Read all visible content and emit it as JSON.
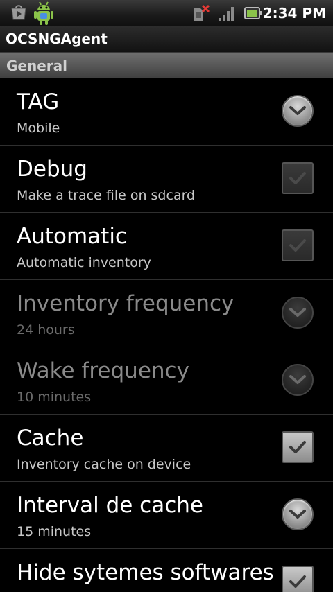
{
  "status_bar": {
    "time": "2:34 PM",
    "icons": [
      "play-store-notification-icon",
      "android-robot-notification-icon",
      "no-sim-icon",
      "signal-strength-icon",
      "battery-icon"
    ]
  },
  "app": {
    "title": "OCSNGAgent"
  },
  "category": {
    "label": "General"
  },
  "preferences": [
    {
      "title": "TAG",
      "summary": "Mobile",
      "widget": "dropdown",
      "enabled": true
    },
    {
      "title": "Debug",
      "summary": "Make a trace file on sdcard",
      "widget": "checkbox",
      "checked": false,
      "enabled": true
    },
    {
      "title": "Automatic",
      "summary": "Automatic inventory",
      "widget": "checkbox",
      "checked": false,
      "enabled": true
    },
    {
      "title": "Inventory frequency",
      "summary": "24 hours",
      "widget": "dropdown",
      "enabled": false
    },
    {
      "title": "Wake frequency",
      "summary": "10 minutes",
      "widget": "dropdown",
      "enabled": false
    },
    {
      "title": "Cache",
      "summary": "Inventory cache on device",
      "widget": "checkbox",
      "checked": true,
      "enabled": true
    },
    {
      "title": "Interval de cache",
      "summary": "15 minutes",
      "widget": "dropdown",
      "enabled": true
    },
    {
      "title": "Hide sytemes softwares",
      "summary": "",
      "widget": "checkbox",
      "checked": true,
      "enabled": true
    }
  ],
  "colors": {
    "background": "#000000",
    "category_bg": "#5a5a5a",
    "title_text": "#ffffff",
    "disabled_text": "#8a8a8a",
    "checkmark": "#3a3a3a"
  }
}
